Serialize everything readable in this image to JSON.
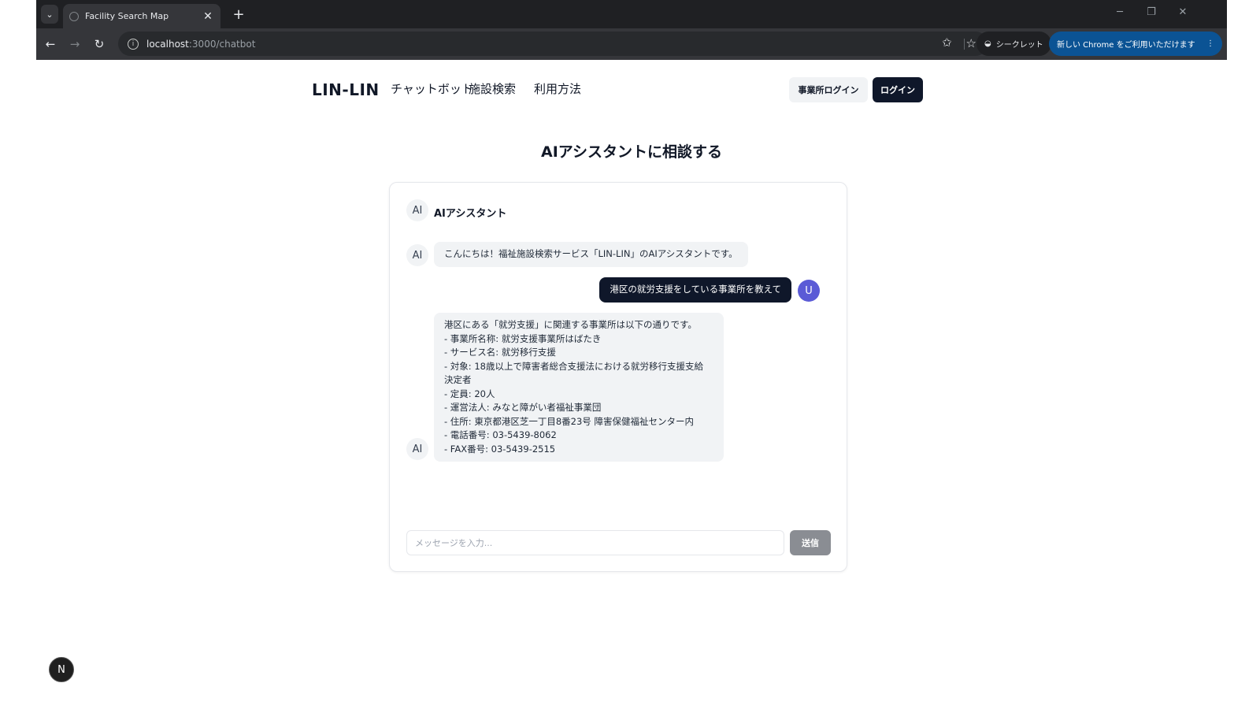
{
  "browser": {
    "tab_title": "Facility Search Map",
    "url_host": "localhost",
    "url_path": ":3000/chatbot",
    "incognito_label": "シークレット",
    "update_label": "新しい Chrome をご利用いただけます",
    "tab_close": "✕",
    "new_tab": "+",
    "dropdown": "⌄",
    "minimize": "─",
    "restore": "❐",
    "close": "✕"
  },
  "header": {
    "logo": "LIN-LIN",
    "nav": [
      "チャットボット",
      "施設検索",
      "利用方法"
    ],
    "office_login": "事業所ログイン",
    "login": "ログイン"
  },
  "page": {
    "title": "AIアシスタントに相談する"
  },
  "chat": {
    "header_avatar": "AI",
    "header_title": "AIアシスタント",
    "messages": [
      {
        "role": "assistant",
        "avatar": "AI",
        "lines": [
          "こんにちは！福祉施設検索サービス「LIN-LIN」のAIアシスタントです。"
        ]
      },
      {
        "role": "user",
        "avatar": "U",
        "lines": [
          "港区の就労支援をしている事業所を教えて"
        ]
      },
      {
        "role": "assistant",
        "avatar": "AI",
        "lines": [
          "港区にある「就労支援」に関連する事業所は以下の通りです。",
          "- 事業所名称: 就労支援事業所はばたき",
          "- サービス名: 就労移行支援",
          "- 対象: 18歳以上で障害者総合支援法における就労移行支援支給",
          "決定者",
          "- 定員: 20人",
          "- 運営法人: みなと障がい者福祉事業団",
          "- 住所: 東京都港区芝一丁目8番23号 障害保健福祉センター内",
          "- 電話番号: 03-5439-8062",
          "- FAX番号: 03-5439-2515"
        ]
      }
    ],
    "input_placeholder": "メッセージを入力...",
    "input_value": "",
    "send_label": "送信"
  },
  "dev_badge": "N"
}
